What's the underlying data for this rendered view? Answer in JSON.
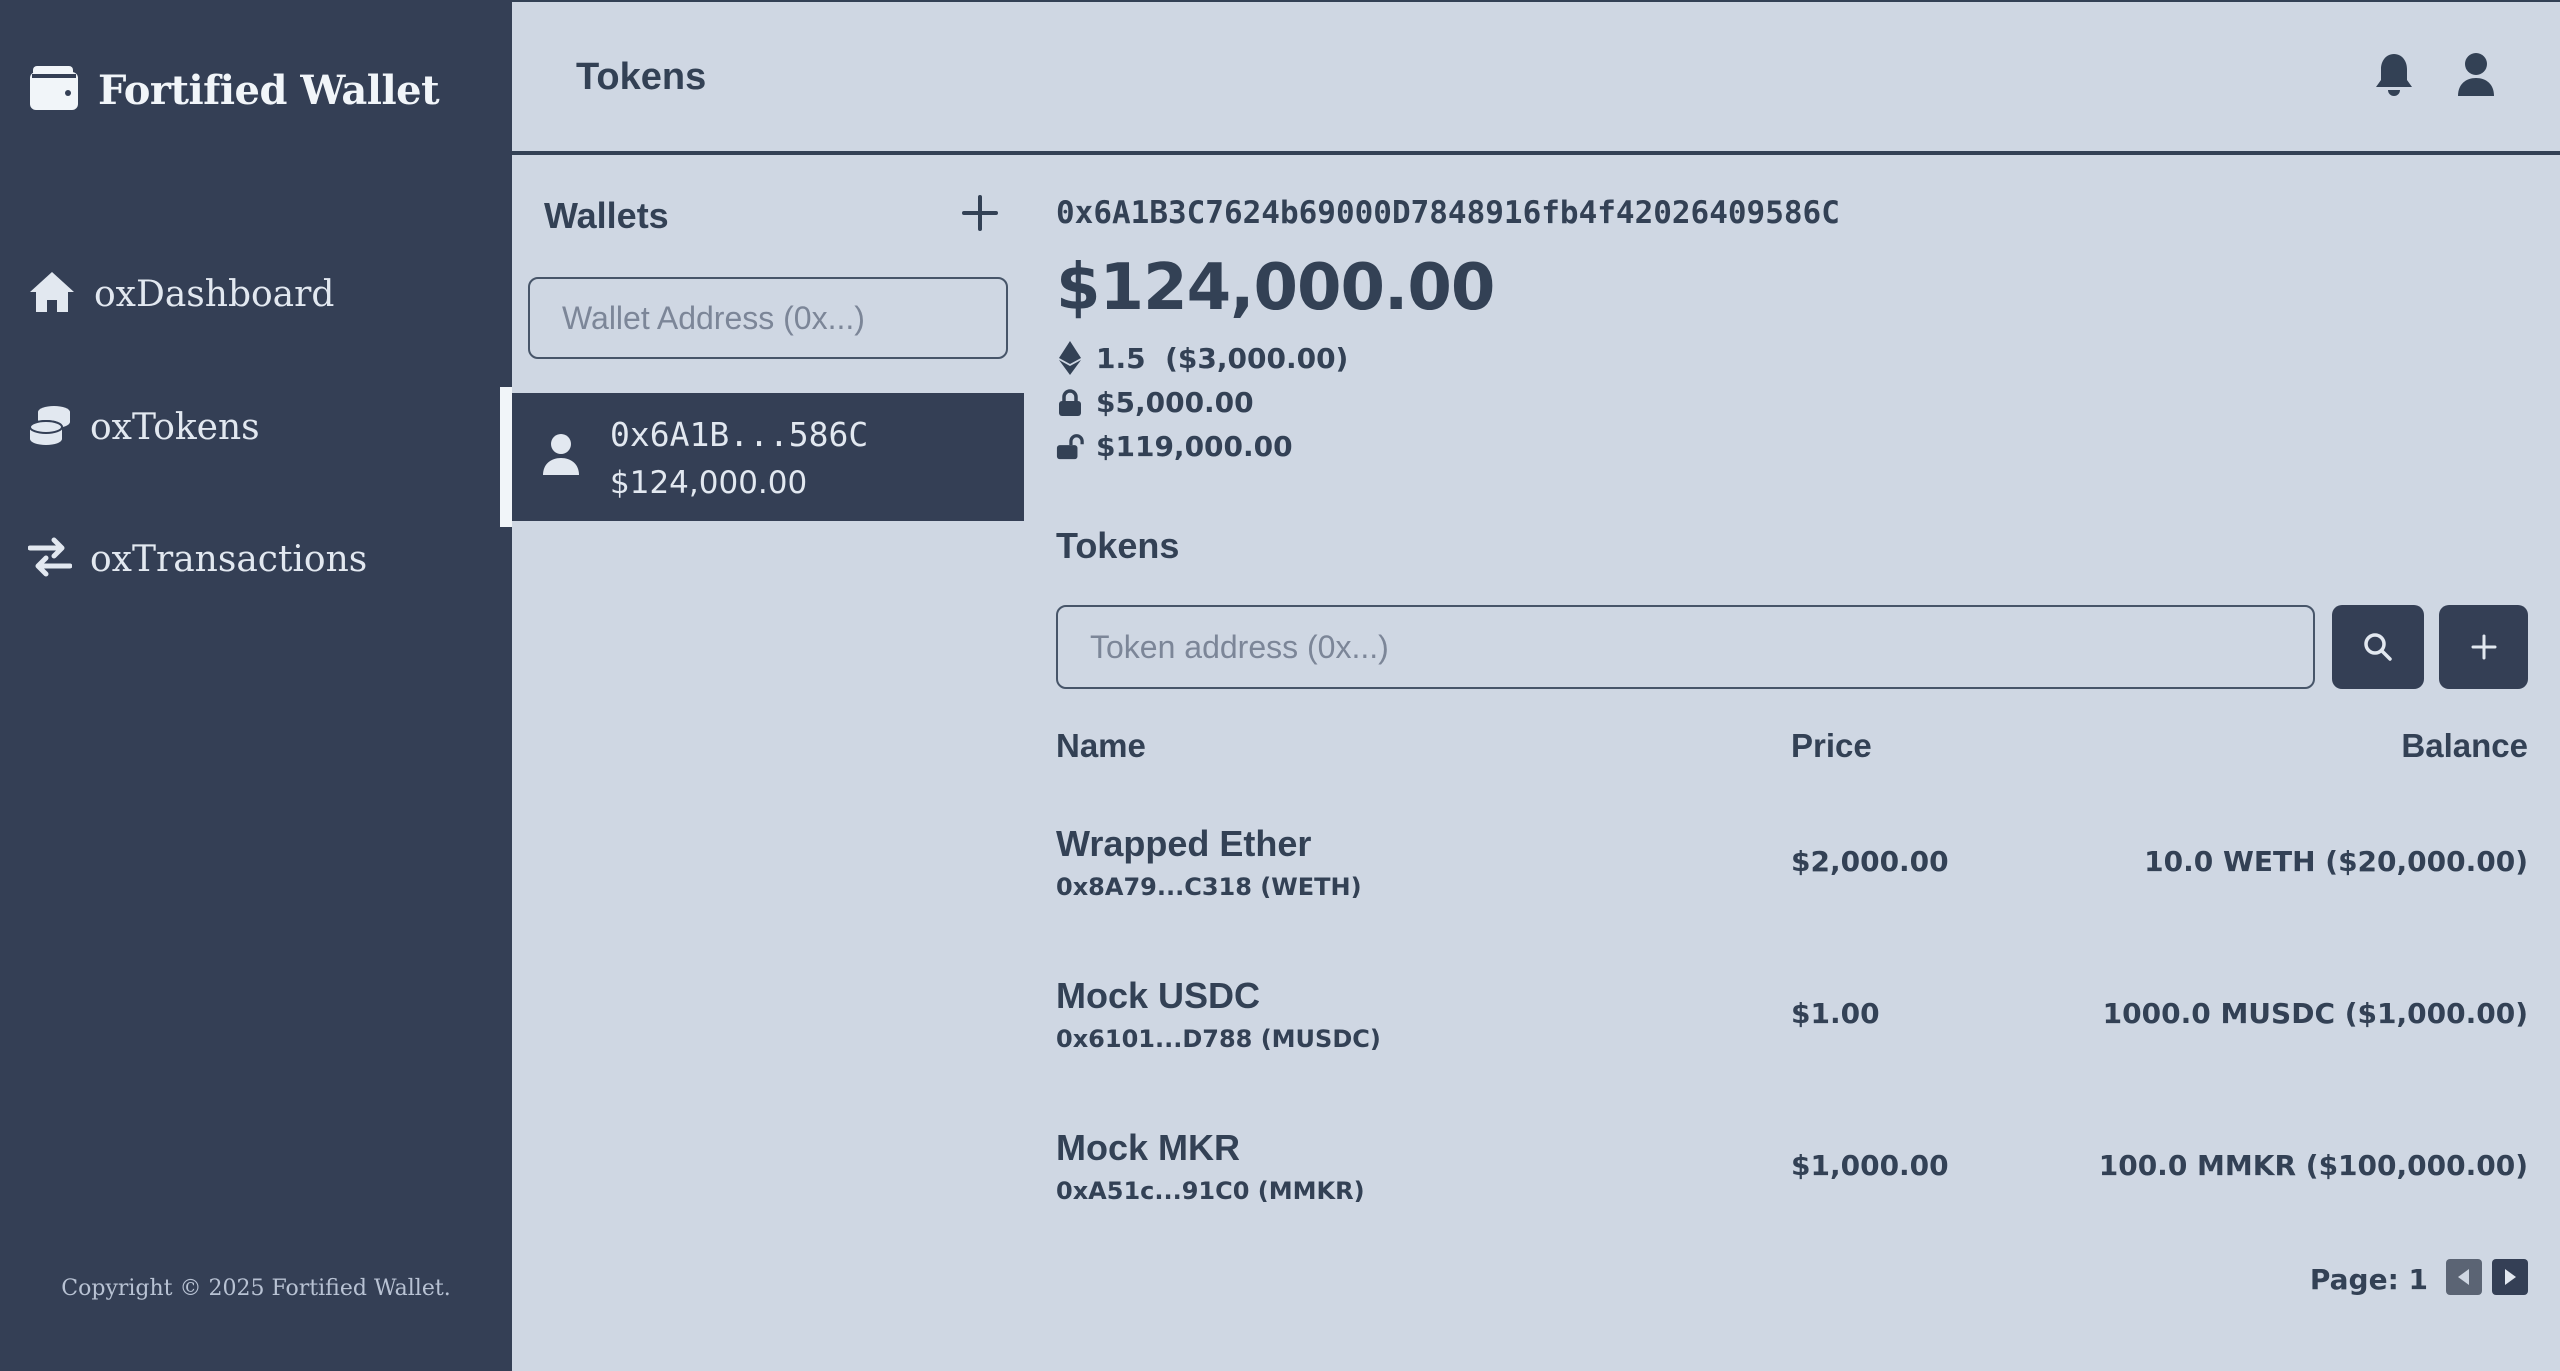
{
  "app": {
    "title": "Fortified Wallet",
    "copyright": "Copyright © 2025 Fortified Wallet."
  },
  "sidebar": {
    "items": [
      {
        "label": "oxDashboard",
        "icon": "home-icon"
      },
      {
        "label": "oxTokens",
        "icon": "coins-icon"
      },
      {
        "label": "oxTransactions",
        "icon": "transfer-icon"
      }
    ]
  },
  "header": {
    "title": "Tokens",
    "icons": [
      "bell-icon",
      "user-icon"
    ]
  },
  "wallets": {
    "title": "Wallets",
    "input_placeholder": "Wallet Address (0x...)",
    "items": [
      {
        "address": "0x6A1B...586C",
        "balance": "$124,000.00"
      }
    ]
  },
  "wallet_detail": {
    "address": "0x6A1B3C7624b69000D7848916fb4f42026409586C",
    "total": "$124,000.00",
    "eth": "1.5  ($3,000.00)",
    "locked": "$5,000.00",
    "unlocked": "$119,000.00"
  },
  "tokens": {
    "title": "Tokens",
    "input_placeholder": "Token address (0x...)",
    "columns": {
      "name": "Name",
      "price": "Price",
      "balance": "Balance"
    },
    "rows": [
      {
        "name": "Wrapped Ether",
        "sub": "0x8A79...C318 (WETH)",
        "price": "$2,000.00",
        "balance": "10.0 WETH ($20,000.00)"
      },
      {
        "name": "Mock USDC",
        "sub": "0x6101...D788 (MUSDC)",
        "price": "$1.00",
        "balance": "1000.0 MUSDC ($1,000.00)"
      },
      {
        "name": "Mock MKR",
        "sub": "0xA51c...91C0 (MMKR)",
        "price": "$1,000.00",
        "balance": "100.0 MMKR ($100,000.00)"
      }
    ],
    "page_label": "Page: 1"
  },
  "colors": {
    "sidebar": "#343f55",
    "background": "#cfd7e3",
    "text": "#334155",
    "light_text": "#e2e8f0"
  }
}
